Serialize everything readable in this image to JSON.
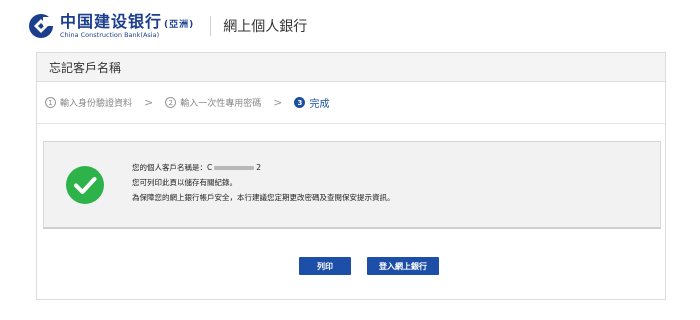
{
  "header": {
    "bank_name_cn": "中国建设银行",
    "bank_name_asia": "(亞洲)",
    "bank_name_en": "China Construction Bank(Asia)",
    "page_heading": "網上個人銀行",
    "brand_color": "#1c3f8c"
  },
  "panel": {
    "title": "忘記客戶名稱"
  },
  "steps": [
    {
      "num": "1",
      "label": "輸入身份驗證資料",
      "state": "done"
    },
    {
      "num": "2",
      "label": "輸入一次性專用密碼",
      "state": "done"
    },
    {
      "num": "3",
      "label": "完成",
      "state": "active"
    }
  ],
  "step_separator": ">",
  "result": {
    "icon": "check-circle-icon",
    "line1_prefix": "您的個人客戶名稱是：",
    "line1_masked_start": "C",
    "line1_masked_end": "2",
    "line2": "您可列印此頁以儲存有關紀錄。",
    "line3": "為保障您的網上銀行帳戶安全，本行建議您定期更改密碼及查閱保安提示資訊。",
    "success_color": "#2db34a"
  },
  "buttons": {
    "print": "列印",
    "login": "登入網上銀行",
    "color": "#1e4fa8"
  }
}
